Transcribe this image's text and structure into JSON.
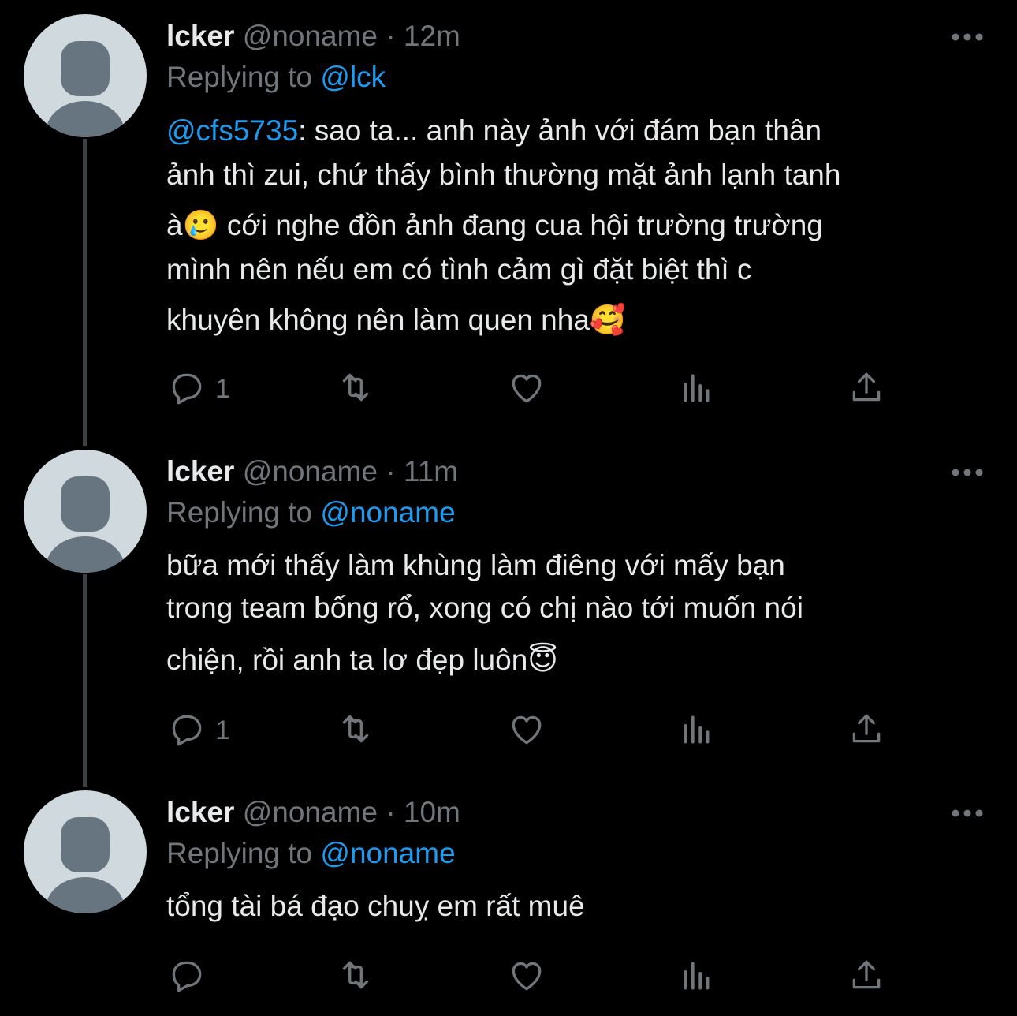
{
  "tweets": [
    {
      "name": "lcker",
      "handle": "@noname",
      "separator": "·",
      "time": "12m",
      "replying_prefix": "Replying to",
      "replying_to": "@lck",
      "mention": "@cfs5735",
      "lines": [
        ": sao ta... anh này ảnh với đám bạn thân",
        "ảnh thì zui, chứ thấy bình thường mặt ảnh lạnh tanh",
        "à🥲  cới nghe đồn ảnh đang cua hội trường trường",
        "mình nên nếu em có tình cảm gì đặt biệt thì c",
        "khuyên không nên làm quen nha🥰"
      ],
      "reply_count": "1"
    },
    {
      "name": "lcker",
      "handle": "@noname",
      "separator": "·",
      "time": "11m",
      "replying_prefix": "Replying to",
      "replying_to": "@noname",
      "lines": [
        "bữa mới thấy làm khùng làm điêng với mấy bạn",
        "trong team bống rổ, xong có chị nào tới muốn nói",
        "chiện, rồi anh ta lơ đẹp luôn😇"
      ],
      "reply_count": "1"
    },
    {
      "name": "lcker",
      "handle": "@noname",
      "separator": "·",
      "time": "10m",
      "replying_prefix": "Replying to",
      "replying_to": "@noname",
      "lines": [
        "tổng tài bá đạo chuỵ em rất muê"
      ],
      "reply_count": ""
    }
  ],
  "icons": {
    "reply": "reply-icon",
    "retweet": "retweet-icon",
    "like": "heart-icon",
    "views": "views-icon",
    "share": "share-icon",
    "more": "more-icon"
  },
  "colors": {
    "background": "#000000",
    "text": "#e7e9ea",
    "muted": "#71767b",
    "accent": "#1d9bf0",
    "thread_line": "#3e4144"
  }
}
